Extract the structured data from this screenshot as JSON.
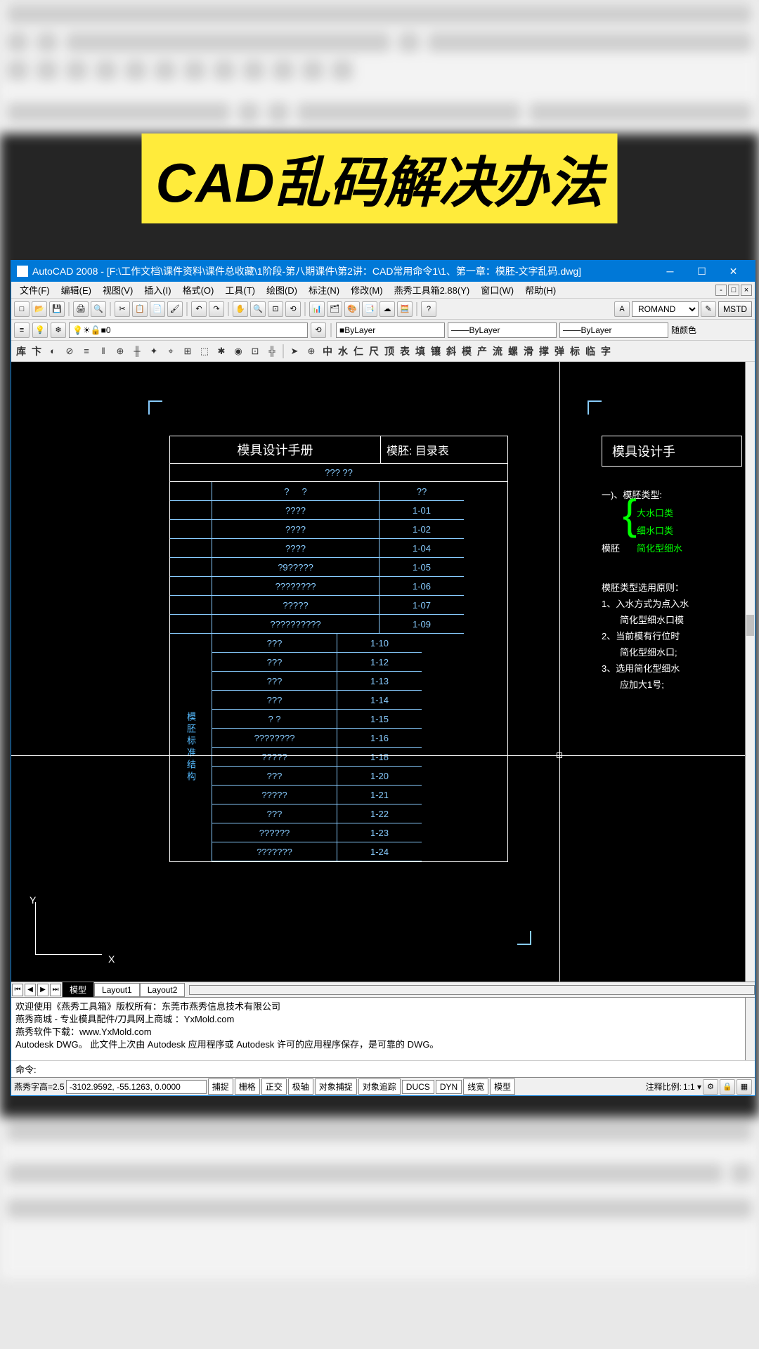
{
  "banner": "CAD乱码解决办法",
  "titlebar": {
    "app": "AutoCAD 2008",
    "path": "[F:\\工作文档\\课件资料\\课件总收藏\\1阶段-第八期课件\\第2讲：CAD常用命令1\\1、第一章：模胚-文字乱码.dwg]"
  },
  "menus": [
    "文件(F)",
    "编辑(E)",
    "视图(V)",
    "插入(I)",
    "格式(O)",
    "工具(T)",
    "绘图(D)",
    "标注(N)",
    "修改(M)",
    "燕秀工具箱2.88(Y)",
    "窗口(W)",
    "帮助(H)"
  ],
  "font_combo": "ROMAND",
  "mstd_button": "MSTD",
  "layer": {
    "current": "0",
    "bylayer": "ByLayer",
    "random_color": "随颜色"
  },
  "palette_icons": [
    "库",
    "卞"
  ],
  "palette_text": [
    "库",
    "中",
    "水",
    "仁",
    "尺",
    "顶",
    "表",
    "填",
    "镶",
    "斜",
    "模",
    "产",
    "流",
    "螺",
    "滑",
    "撑",
    "弹",
    "标",
    "临",
    "字"
  ],
  "drawing": {
    "title1": "模具设计手册",
    "title2": "模胚: 目录表",
    "title_right": "模具设计手",
    "subhead": "???  ??",
    "table_head": [
      "?",
      "?",
      "??"
    ],
    "side_label": "模胚标准结构",
    "rows_top": [
      {
        "c2": "????",
        "c3": "1-01"
      },
      {
        "c2": "????",
        "c3": "1-02"
      },
      {
        "c2": "????",
        "c3": "1-04"
      },
      {
        "c2": "?9?????",
        "c3": "1-05"
      },
      {
        "c2": "????????",
        "c3": "1-06"
      },
      {
        "c2": "?????",
        "c3": "1-07"
      },
      {
        "c2": "??????????",
        "c3": "1-09"
      }
    ],
    "rows_bottom": [
      {
        "c2": "???",
        "c3": "1-10"
      },
      {
        "c2": "???",
        "c3": "1-12"
      },
      {
        "c2": "???",
        "c3": "1-13"
      },
      {
        "c2": "???",
        "c3": "1-14"
      },
      {
        "c2": "? ?",
        "c3": "1-15"
      },
      {
        "c2": "????????",
        "c3": "1-16"
      },
      {
        "c2": "?????",
        "c3": "1-18"
      },
      {
        "c2": "???",
        "c3": "1-20"
      },
      {
        "c2": "?????",
        "c3": "1-21"
      },
      {
        "c2": "???",
        "c3": "1-22"
      },
      {
        "c2": "??????",
        "c3": "1-23"
      },
      {
        "c2": "???????",
        "c3": "1-24"
      }
    ],
    "right_section": {
      "heading": "一)、模胚类型:",
      "green_items": [
        "大水口类",
        "细水口类",
        "简化型细水"
      ],
      "brace_label": "模胚",
      "rules_title": "模胚类型选用原则：",
      "rules": [
        "1、入水方式为点入水",
        "　　简化型细水口模",
        "2、当前模有行位时",
        "　　简化型细水口;",
        "3、选用简化型细水",
        "　　应加大1号;"
      ]
    }
  },
  "ucs": {
    "x": "X",
    "y": "Y"
  },
  "tabs": [
    "模型",
    "Layout1",
    "Layout2"
  ],
  "cmd_lines": [
    "欢迎使用《燕秀工具箱》版权所有：东莞市燕秀信息技术有限公司",
    "燕秀商城 - 专业模具配件/刀具网上商城 ：YxMold.com",
    "燕秀软件下载：www.YxMold.com",
    "Autodesk DWG。  此文件上次由 Autodesk 应用程序或 Autodesk 许可的应用程序保存，是可靠的 DWG。"
  ],
  "cmd_prompt": "命令:",
  "status": {
    "prefix": "燕秀字高=2.5",
    "coords": "-3102.9592, -55.1263, 0.0000",
    "toggles": [
      "捕捉",
      "栅格",
      "正交",
      "极轴",
      "对象捕捉",
      "对象追踪",
      "DUCS",
      "DYN",
      "线宽",
      "模型"
    ],
    "scale_label": "注释比例:",
    "scale": "1:1 ▾"
  }
}
